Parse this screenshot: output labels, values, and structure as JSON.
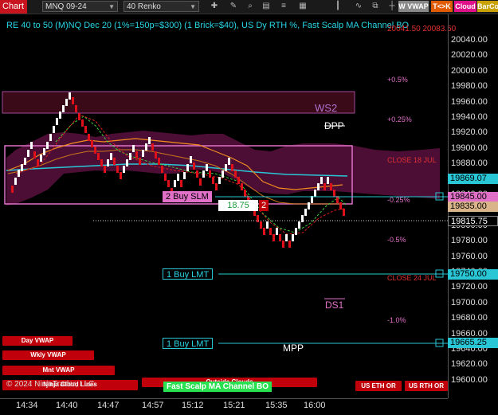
{
  "toolbar": {
    "chart_label": "Chart",
    "instrument": "MNQ 09-24",
    "bar_type": "40 Renko",
    "wvwap_label": "W VWAP",
    "tk_label": "T<>K",
    "cloud_label": "Cloud",
    "barco_label": "BarCo"
  },
  "header": {
    "title": "RE 40 to 50 (M)NQ Dec 20 (1%=150p=$300) (1 Brick=$40), US Dy RTH %, Fast Scalp MA Channel BO",
    "top_price_overlay": "20041.50 20083.50"
  },
  "price_axis": {
    "ticks": [
      "20040.00",
      "20020.00",
      "20000.00",
      "19980.00",
      "19960.00",
      "19940.00",
      "19920.00",
      "19900.00",
      "19880.00",
      "19860.00",
      "19840.00",
      "19820.00",
      "19800.00",
      "19780.00",
      "19760.00",
      "19740.00",
      "19720.00",
      "19700.00",
      "19680.00",
      "19660.00",
      "19640.00",
      "19620.00",
      "19600.00"
    ],
    "boxes": {
      "p1": "19869.07",
      "p2": "19845.00",
      "p3": "19835.00",
      "p4": "19815.75",
      "p5": "19750.00",
      "p6": "19665.25"
    }
  },
  "time_axis": [
    "14:34",
    "14:40",
    "14:47",
    "14:57",
    "15:12",
    "15:21",
    "15:35",
    "16:00"
  ],
  "levels": {
    "pct_plus_05": "+0.5%",
    "pct_plus_025": "+0.25%",
    "close_18": "CLOSE 18 JUL",
    "pct_minus_025": "-0.25%",
    "pct_minus_05": "-0.5%",
    "close_24": "CLOSE 24 JUL",
    "pct_minus_1": "-1.0%",
    "ws2": "WS2",
    "dpp": "DPP",
    "ds1": "DS1",
    "mpp": "MPP"
  },
  "orders": {
    "buy_slm": "2 Buy SLM",
    "stop_price": "18.75",
    "qty": "2",
    "buy_lmt_1": "1 Buy LMT",
    "buy_lmt_2": "1 Buy LMT"
  },
  "buttons": {
    "day_vwap": "Day VWAP",
    "wkly_vwap": "Wkly VWAP",
    "mnt_vwap": "Mnt VWAP",
    "ninja_lines": "Ninja Cloud Lines",
    "fast_scalp": "Fast Scalp MA Channel BO",
    "outside_clouds": "Outside Clouds",
    "us_eth_or": "US ETH OR",
    "us_rth_or": "US RTH OR"
  },
  "copyright": "© 2024 NinjaTrader, LLC",
  "colors": {
    "up_brick": "#ffffff",
    "down_brick": "#e0101a",
    "cloud": "#5a1040",
    "cyan_line": "#29c6d6",
    "orange_line": "#f08c1e",
    "green_order": "#28e050",
    "pink_box": "#e070c8"
  },
  "icons": [
    "crosshair-icon",
    "draw-tools-icon",
    "zoom-icon",
    "template-icon",
    "properties-icon",
    "data-box-icon",
    "bar-icon",
    "indicator-icon",
    "strategy-icon"
  ]
}
